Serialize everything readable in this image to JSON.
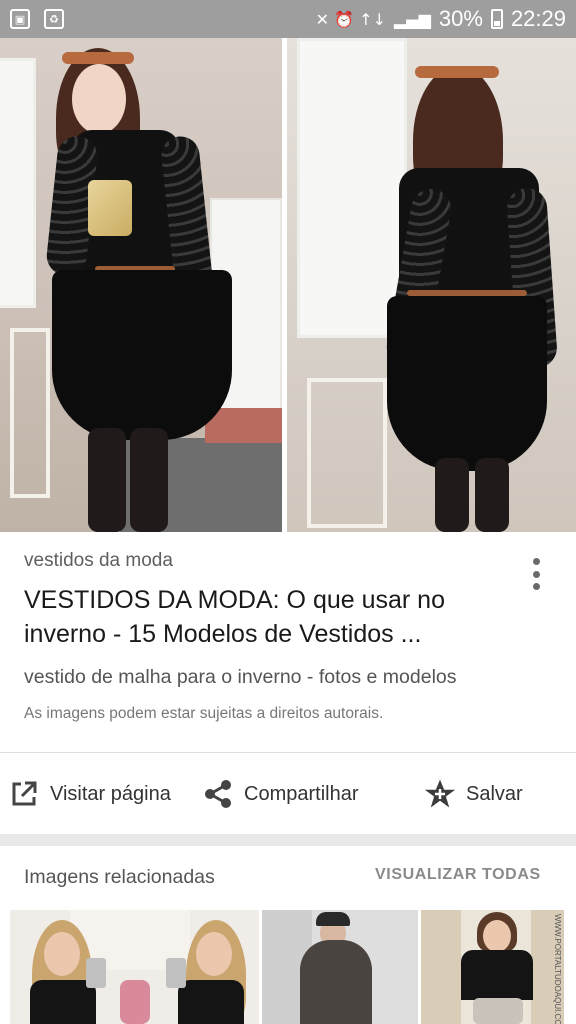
{
  "status_bar": {
    "icons_left": [
      "image-icon",
      "recycle-icon"
    ],
    "signal_glyphs": "✕ ⏰ ↑↓",
    "battery_percent": "30%",
    "time": "22:29"
  },
  "result": {
    "site_name": "vestidos da moda",
    "title": "VESTIDOS DA MODA: O que usar no inverno - 15 Modelos de Vestidos ...",
    "description": "vestido de malha para o inverno - fotos e modelos",
    "copyright_notice": "As imagens podem estar sujeitas a direitos autorais."
  },
  "actions": {
    "visit_label": "Visitar página",
    "share_label": "Compartilhar",
    "save_label": "Salvar"
  },
  "related": {
    "heading": "Imagens relacionadas",
    "view_all_label": "VISUALIZAR TODAS",
    "thumbnail_3_watermark": "WWW.PORTALTUDOAQUI.COM.BR"
  },
  "colors": {
    "status_bar": "#9e9e9e",
    "card_background": "#ffffff",
    "page_background": "#e8e8e8"
  }
}
